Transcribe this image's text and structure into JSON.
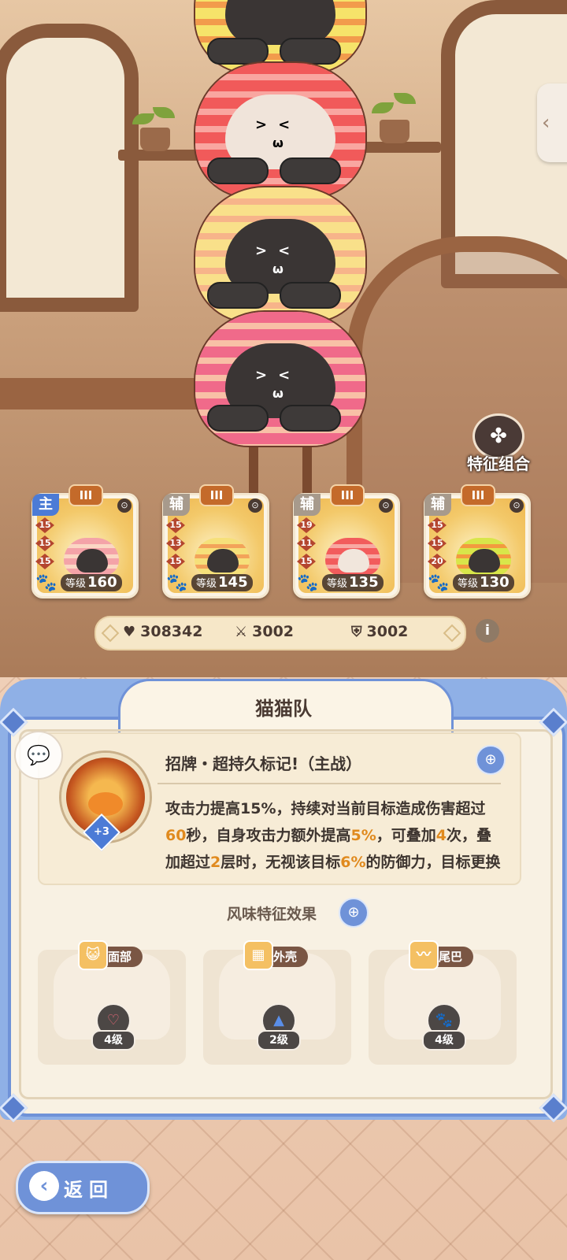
{
  "feature_combo": {
    "label": "特征组合",
    "icon": "clover-icon"
  },
  "team": [
    {
      "role": "主",
      "tier": "III",
      "stats": [
        "15",
        "15",
        "15"
      ],
      "level_label": "等级",
      "level": "160"
    },
    {
      "role": "辅",
      "tier": "III",
      "stats": [
        "15",
        "13",
        "15"
      ],
      "level_label": "等级",
      "level": "145"
    },
    {
      "role": "辅",
      "tier": "III",
      "stats": [
        "19",
        "11",
        "15"
      ],
      "level_label": "等级",
      "level": "135"
    },
    {
      "role": "辅",
      "tier": "III",
      "stats": [
        "15",
        "15",
        "20"
      ],
      "level_label": "等级",
      "level": "130"
    }
  ],
  "totals": {
    "hp": "308342",
    "attack": "3002",
    "defense": "3002"
  },
  "panel": {
    "title": "猫猫队",
    "skill": {
      "plus": "+3",
      "name": "招牌・超持久标记!（主战）",
      "desc_parts": [
        {
          "t": "攻击力提高15%，持续对当前目标造成伤害超过",
          "h": false
        },
        {
          "t": "60",
          "h": true
        },
        {
          "t": "秒，自身攻击力额外提高",
          "h": false
        },
        {
          "t": "5%",
          "h": true
        },
        {
          "t": "，可叠加",
          "h": false
        },
        {
          "t": "4",
          "h": true
        },
        {
          "t": "次，叠加超过",
          "h": false
        },
        {
          "t": "2",
          "h": true
        },
        {
          "t": "层时，无视该目标",
          "h": false
        },
        {
          "t": "6%",
          "h": true
        },
        {
          "t": "的防御力，目标更换后重置",
          "h": false
        }
      ]
    },
    "flavor_title": "风味特征效果",
    "slots": [
      {
        "tag": "面部",
        "tag_icon": "cat-face-icon",
        "badge_icon": "heart-icon",
        "level": "4级"
      },
      {
        "tag": "外壳",
        "tag_icon": "shell-icon",
        "badge_icon": "triangle-icon",
        "level": "2级"
      },
      {
        "tag": "尾巴",
        "tag_icon": "tail-icon",
        "badge_icon": "paw-icon",
        "level": "4级"
      }
    ]
  },
  "back": {
    "label": "返回"
  },
  "colors": {
    "accent": "#6f92d8",
    "highlight": "#e08a1e",
    "main_role": "#4c7bd6"
  }
}
